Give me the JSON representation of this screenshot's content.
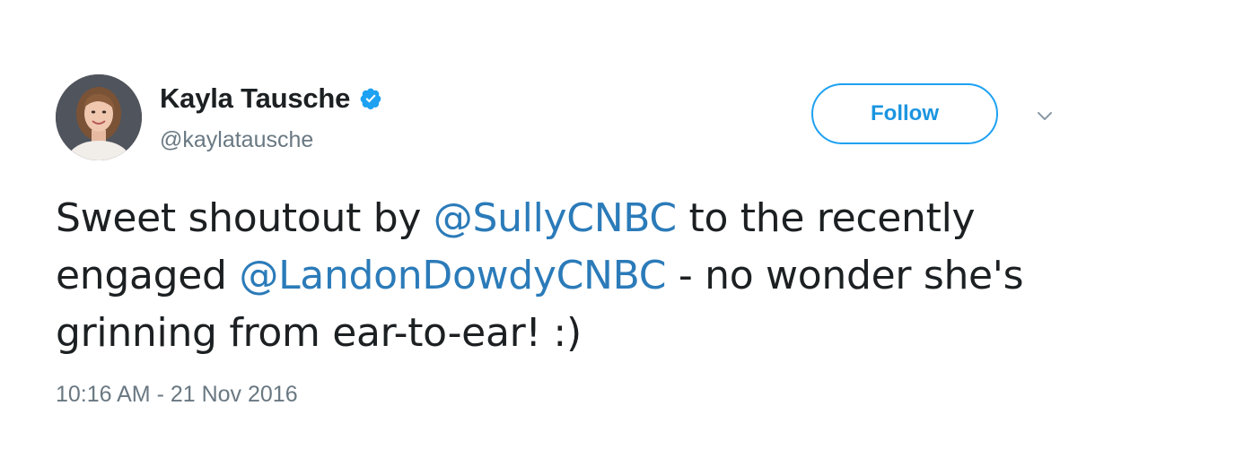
{
  "author": {
    "display_name": "Kayla Tausche",
    "handle": "@kaylatausche",
    "verified": true,
    "verified_icon": "verified-badge-icon"
  },
  "actions": {
    "follow_label": "Follow",
    "menu_icon": "chevron-down-icon"
  },
  "tweet": {
    "segments": {
      "t1": "Sweet shoutout by ",
      "m1": "@SullyCNBC",
      "t2": " to the recently engaged ",
      "m2": "@LandonDowdyCNBC",
      "t3": " - no wonder she's grinning from ear-to-ear! :)"
    },
    "timestamp": "10:16 AM - 21 Nov 2016"
  },
  "colors": {
    "accent": "#1da1f2",
    "link": "#2b7bb9",
    "text": "#1c2022",
    "muted": "#697882"
  }
}
